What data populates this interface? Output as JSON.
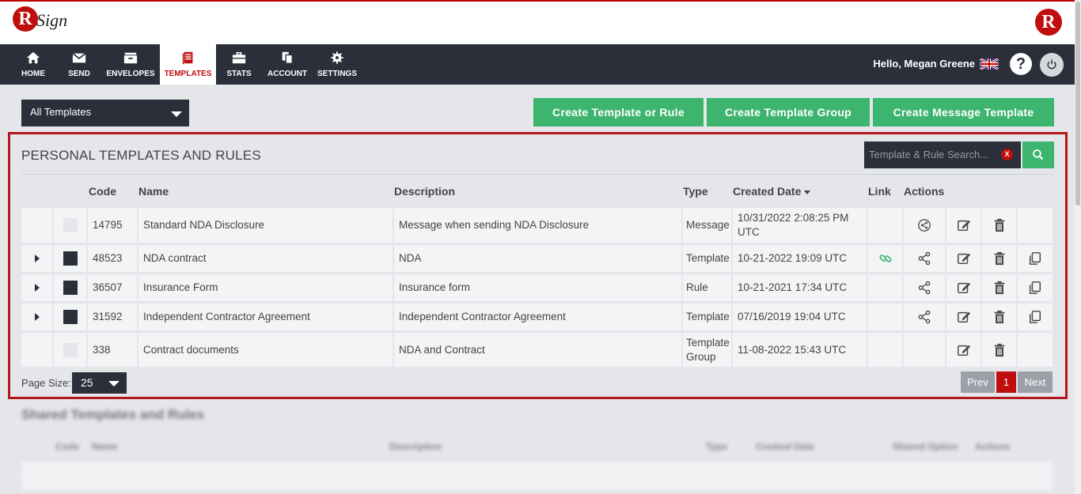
{
  "brand": {
    "logo_letter": "R",
    "logo_word": "Sign",
    "corner_letter": "R"
  },
  "nav": {
    "items": [
      {
        "label": "HOME",
        "icon": "home-icon"
      },
      {
        "label": "SEND",
        "icon": "envelope-icon"
      },
      {
        "label": "ENVELOPES",
        "icon": "inbox-icon"
      },
      {
        "label": "TEMPLATES",
        "icon": "document-icon",
        "active": true
      },
      {
        "label": "STATS",
        "icon": "briefcase-icon"
      },
      {
        "label": "ACCOUNT",
        "icon": "files-icon"
      },
      {
        "label": "SETTINGS",
        "icon": "gear-icon"
      }
    ],
    "greeting": "Hello, Megan Greene",
    "help": "?"
  },
  "filter": {
    "selected": "All Templates"
  },
  "actions": {
    "create_template": "Create Template or Rule",
    "create_group": "Create Template Group",
    "create_message": "Create Message Template"
  },
  "panel": {
    "title": "PERSONAL TEMPLATES AND RULES",
    "search_placeholder": "Template & Rule Search...",
    "search_clear": "X",
    "columns": {
      "code": "Code",
      "name": "Name",
      "description": "Description",
      "type": "Type",
      "created": "Created Date",
      "link": "Link",
      "actions": "Actions"
    },
    "rows": [
      {
        "code": "14795",
        "name": "Standard NDA Disclosure",
        "description": "Message when sending NDA Disclosure",
        "type": "Message",
        "created": "10/31/2022 2:08:25 PM UTC"
      },
      {
        "code": "48523",
        "name": "NDA contract",
        "description": "NDA",
        "type": "Template",
        "created": "10-21-2022 19:09 UTC"
      },
      {
        "code": "36507",
        "name": "Insurance Form",
        "description": "Insurance form",
        "type": "Rule",
        "created": "10-21-2021 17:34 UTC"
      },
      {
        "code": "31592",
        "name": "Independent Contractor Agreement",
        "description": "Independent Contractor Agreement",
        "type": "Template",
        "created": "07/16/2019 19:04 UTC"
      },
      {
        "code": "338",
        "name": "Contract documents",
        "description": "NDA and Contract",
        "type": "Template Group",
        "created": "11-08-2022 15:43 UTC"
      }
    ],
    "page_size_label": "Page Size:",
    "page_size": "25",
    "pager": {
      "prev": "Prev",
      "current": "1",
      "next": "Next"
    }
  },
  "shared": {
    "title": "Shared Templates and Rules",
    "columns": [
      "Code",
      "Name",
      "Description",
      "Type",
      "Created Date",
      "Shared Option",
      "Actions"
    ]
  },
  "colors": {
    "brand_red": "#c00d0d",
    "nav_dark": "#2a2f3a",
    "green": "#3db56f",
    "highlight": "#b3161b"
  }
}
